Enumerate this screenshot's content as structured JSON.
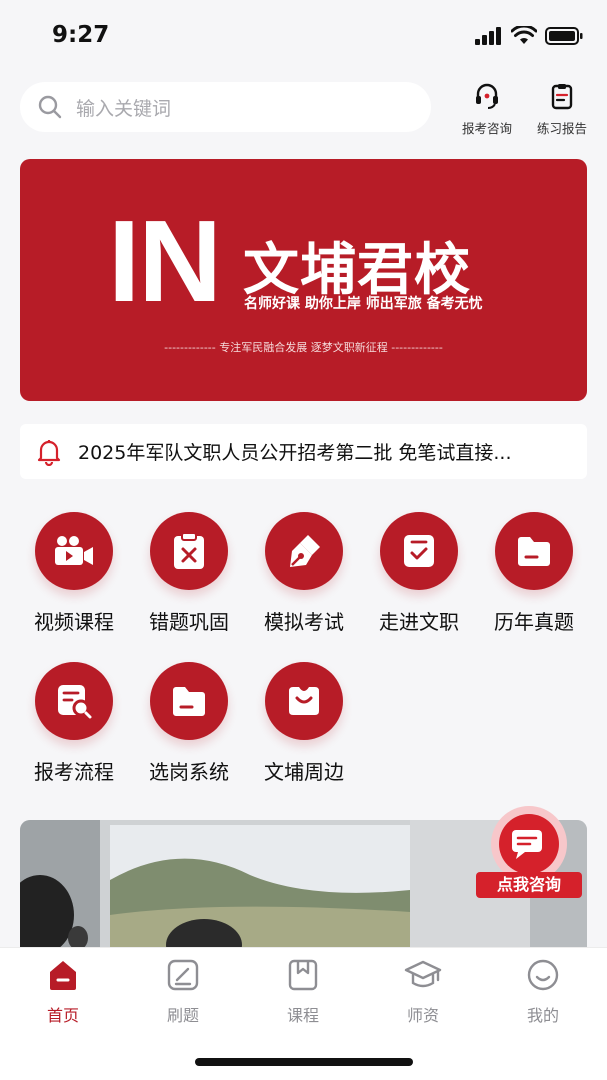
{
  "status_bar": {
    "time": "9:27"
  },
  "search": {
    "placeholder": "输入关键词"
  },
  "top_actions": [
    {
      "label": "报考咨询",
      "icon": "headset-icon"
    },
    {
      "label": "练习报告",
      "icon": "clipboard-report-icon"
    }
  ],
  "banner": {
    "big_text": "IN",
    "brand": "文埔君校",
    "slogan": "名师好课  助你上岸  师出军旅  备考无忧",
    "tagline": "------------- 专注军民融合发展   逐梦文职新征程 -------------"
  },
  "notice": {
    "text": "2025年军队文职人员公开招考第二批 免笔试直接...",
    "icon": "bell-icon"
  },
  "grid": [
    {
      "label": "视频课程",
      "icon": "video-camera-icon"
    },
    {
      "label": "错题巩固",
      "icon": "clipboard-x-icon"
    },
    {
      "label": "模拟考试",
      "icon": "pen-nib-icon"
    },
    {
      "label": "走进文职",
      "icon": "checklist-icon"
    },
    {
      "label": "历年真题",
      "icon": "folder-icon"
    },
    {
      "label": "报考流程",
      "icon": "document-search-icon"
    },
    {
      "label": "选岗系统",
      "icon": "folder-icon"
    },
    {
      "label": "文埔周边",
      "icon": "shopping-bag-icon"
    }
  ],
  "consult_float": {
    "label": "点我咨询"
  },
  "tabbar": [
    {
      "label": "首页",
      "active": true,
      "icon": "home-icon"
    },
    {
      "label": "刷题",
      "active": false,
      "icon": "edit-icon"
    },
    {
      "label": "课程",
      "active": false,
      "icon": "bookmark-book-icon"
    },
    {
      "label": "师资",
      "active": false,
      "icon": "graduation-cap-icon"
    },
    {
      "label": "我的",
      "active": false,
      "icon": "smiley-icon"
    }
  ],
  "colors": {
    "brand_red": "#b71c27",
    "background": "#f6f6f8",
    "inactive_gray": "#8e8e93"
  }
}
